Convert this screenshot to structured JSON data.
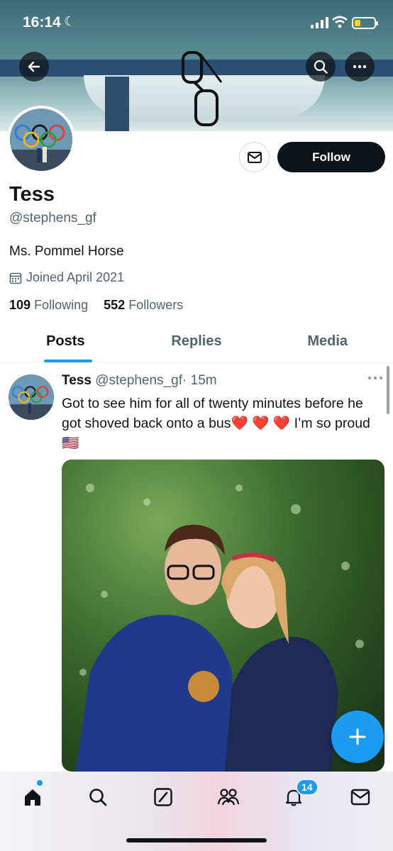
{
  "status_bar": {
    "time": "16:14"
  },
  "profile": {
    "name": "Tess",
    "handle": "@stephens_gf",
    "bio": "Ms. Pommel Horse",
    "joined": "Joined April 2021",
    "following_count": "109",
    "following_label": "Following",
    "followers_count": "552",
    "followers_label": "Followers",
    "follow_label": "Follow"
  },
  "tabs": [
    {
      "label": "Posts",
      "active": true
    },
    {
      "label": "Replies",
      "active": false
    },
    {
      "label": "Media",
      "active": false
    }
  ],
  "post": {
    "author": "Tess",
    "handle": "@stephens_gf",
    "time": "· 15m",
    "text": "Got to see him for all of twenty minutes before he got shoved back onto a bus❤️ ❤️ ❤️ I’m so proud🇺🇸"
  },
  "nav": {
    "items": [
      "home-icon",
      "search-icon",
      "grok-icon",
      "communities-icon",
      "notifications-icon",
      "messages-icon"
    ],
    "notifications_badge": "14"
  },
  "colors": {
    "accent": "#1d9bf0",
    "text": "#0f1419",
    "secondary": "#536471"
  }
}
